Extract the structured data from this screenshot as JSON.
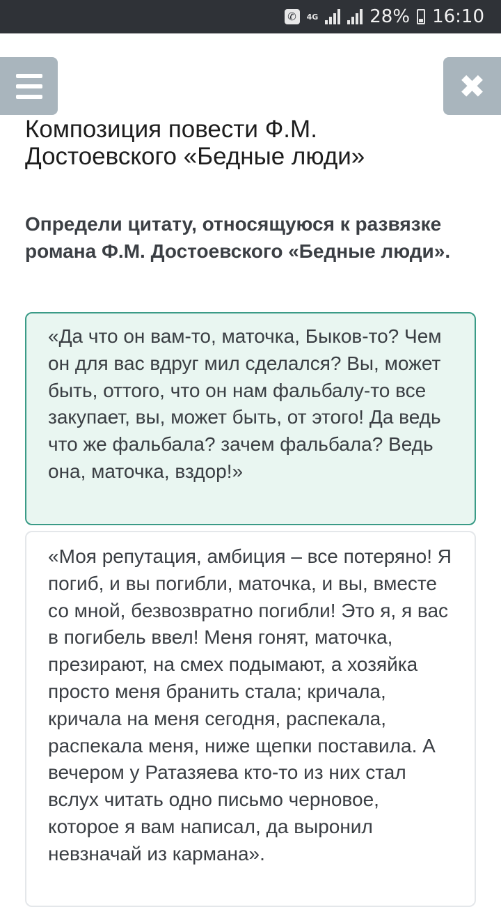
{
  "status_bar": {
    "network": "4G",
    "battery": "28%",
    "time": "16:10",
    "icons": [
      "phone-icon",
      "signal-icon",
      "battery-icon"
    ]
  },
  "header": {
    "menu_icon": "hamburger-menu-icon",
    "close_icon": "close-icon",
    "button_color": "#a9b5bd"
  },
  "page": {
    "title": "Композиция повести Ф.М. Достоевского «Бедные люди»",
    "question": "Определи цитату, относящуюся к развязке романа Ф.М. Достоевского «Бедные люди»."
  },
  "answers": [
    {
      "text": "«Да что он вам-то, маточка, Быков-то? Чем он для вас вдруг мил сделался? Вы, может быть, оттого, что он нам фальбалу-то все закупает, вы, может быть, от этого! Да ведь что же фальбала? зачем фальбала? Ведь она, маточка, вздор!»",
      "selected": true,
      "accent": "#3a9b87"
    },
    {
      "text": "«Моя репутация, амбиция – все потеряно! Я погиб, и вы погибли, маточка, и вы, вместе со мной, безвозвратно погибли! Это я, я вас в погибель ввел! Меня гонят, маточка, презирают, на смех подымают, а хозяйка просто меня бранить стала; кричала, кричала на меня сегодня, распекала, распекала меня, ниже щепки поставила. А вечером у Ратазяева кто-то из них стал вслух читать одно письмо черновое, которое я вам написал, да выронил невзначай из кармана».",
      "selected": false
    }
  ]
}
